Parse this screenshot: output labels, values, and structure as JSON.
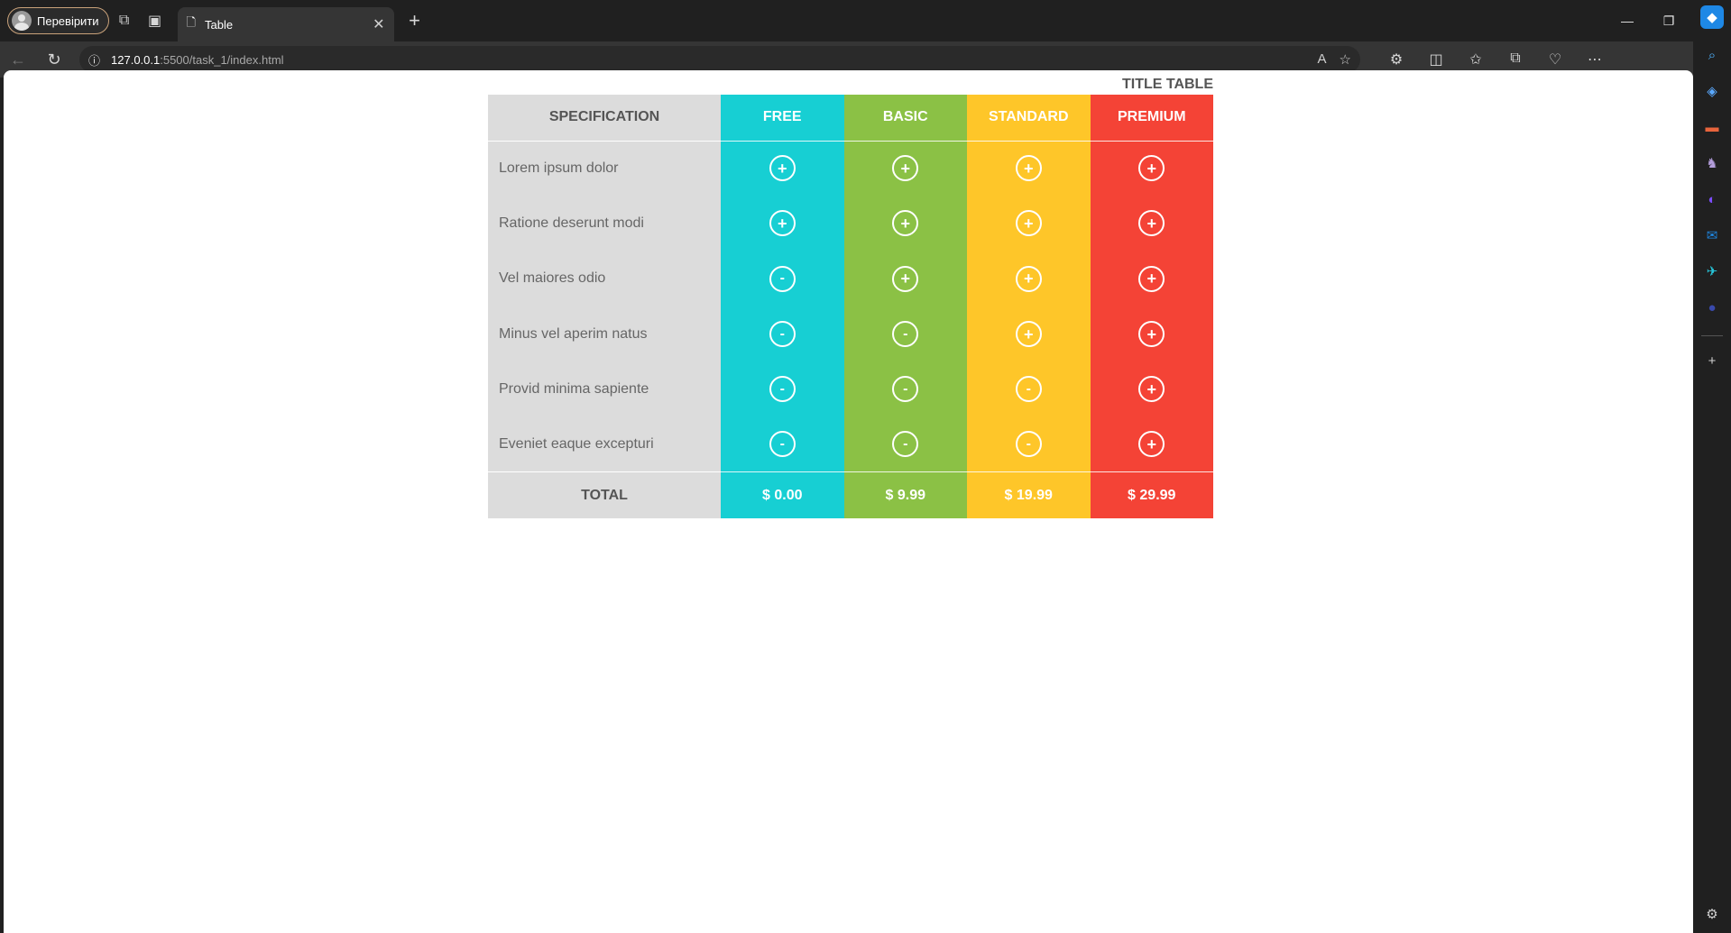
{
  "browser": {
    "profile_label": "Перевірити",
    "tab_title": "Table",
    "url_host": "127.0.0.1",
    "url_path": ":5500/task_1/index.html"
  },
  "page": {
    "title": "TITLE TABLE",
    "spec_header": "SPECIFICATION",
    "plans": [
      {
        "name": "FREE",
        "color": "#17cfd3",
        "price": "$ 0.00"
      },
      {
        "name": "BASIC",
        "color": "#8bc145",
        "price": "$ 9.99"
      },
      {
        "name": "STANDARD",
        "color": "#fec629",
        "price": "$ 19.99"
      },
      {
        "name": "PREMIUM",
        "color": "#f44336",
        "price": "$ 29.99"
      }
    ],
    "rows": [
      {
        "label": "Lorem ipsum dolor",
        "marks": [
          "+",
          "+",
          "+",
          "+"
        ]
      },
      {
        "label": "Ratione deserunt modi",
        "marks": [
          "+",
          "+",
          "+",
          "+"
        ]
      },
      {
        "label": "Vel maiores odio",
        "marks": [
          "-",
          "+",
          "+",
          "+"
        ]
      },
      {
        "label": "Minus vel aperim natus",
        "marks": [
          "-",
          "-",
          "+",
          "+"
        ]
      },
      {
        "label": "Provid minima sapiente",
        "marks": [
          "-",
          "-",
          "-",
          "+"
        ]
      },
      {
        "label": "Eveniet eaque excepturi",
        "marks": [
          "-",
          "-",
          "-",
          "+"
        ]
      }
    ],
    "total_label": "TOTAL"
  }
}
